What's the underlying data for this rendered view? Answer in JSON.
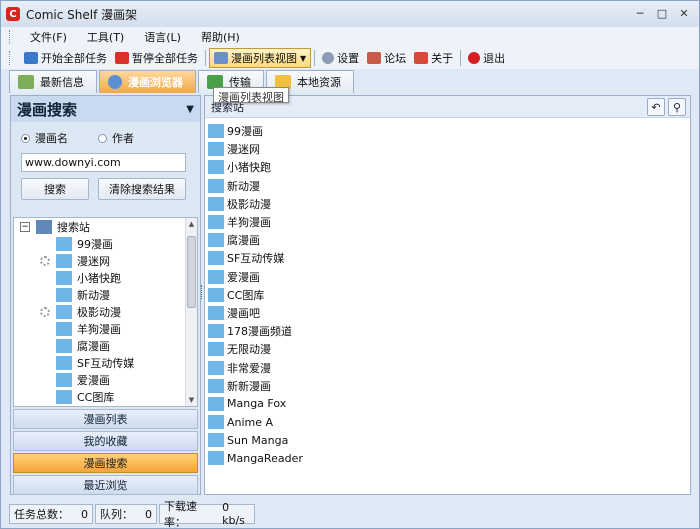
{
  "window": {
    "title": "Comic Shelf 漫画架",
    "icon": "app-logo-icon"
  },
  "menu": [
    "文件(F)",
    "工具(T)",
    "语言(L)",
    "帮助(H)"
  ],
  "toolbar": {
    "start_all": "开始全部任务",
    "pause_all": "暂停全部任务",
    "list_view": "漫画列表视图",
    "settings": "设置",
    "forum": "论坛",
    "about": "关于",
    "exit": "退出"
  },
  "tabs": [
    "最新信息",
    "漫画浏览器",
    "传输",
    "本地资源"
  ],
  "tooltip": "漫画列表视图",
  "left": {
    "title": "漫画搜索",
    "radio_name": "漫画名",
    "radio_author": "作者",
    "search_value": "www.downyi.com",
    "search_button": "搜索",
    "clear_button": "清除搜索结果",
    "tree_root": "搜索站",
    "tree_items": [
      "99漫画",
      "漫迷网",
      "小猪快跑",
      "新动漫",
      "极影动漫",
      "羊狗漫画",
      "腐漫画",
      "SF互动传媒",
      "爱漫画",
      "CC图库"
    ],
    "nav": [
      "漫画列表",
      "我的收藏",
      "漫画搜索",
      "最近浏览"
    ]
  },
  "right": {
    "header": "搜索站",
    "sites": [
      "99漫画",
      "漫迷网",
      "小猪快跑",
      "新动漫",
      "极影动漫",
      "羊狗漫画",
      "腐漫画",
      "SF互动传媒",
      "爱漫画",
      "CC图库",
      "漫画吧",
      "178漫画频道",
      "无限动漫",
      "非常爱漫",
      "新新漫画",
      "Manga Fox",
      "Anime A",
      "Sun Manga",
      "MangaReader"
    ]
  },
  "status": {
    "total_label": "任务总数：",
    "total_value": "0",
    "queue_label": "队列：",
    "queue_value": "0",
    "speed_label": "下载速率：",
    "speed_value": "0 kb/s"
  },
  "colors": {
    "accent": "#f3a847",
    "panel": "#dce7f4",
    "border": "#9db0c9"
  }
}
